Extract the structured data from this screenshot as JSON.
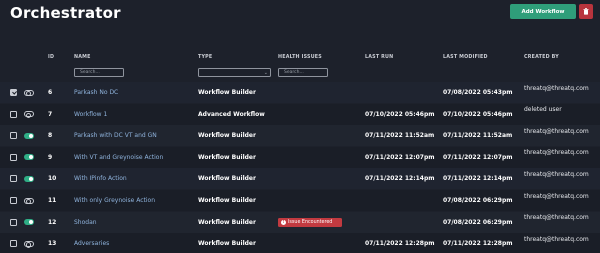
{
  "header": {
    "title": "Orchestrator",
    "add_label": "Add Workflow",
    "delete_icon": "trash-icon"
  },
  "columns": {
    "id": "ID",
    "name": "NAME",
    "type": "TYPE",
    "health": "HEALTH ISSUES",
    "last_run": "LAST RUN",
    "last_modified": "LAST MODIFIED",
    "created_by": "CREATED BY"
  },
  "filters": {
    "name_placeholder": "Search...",
    "type_value": "",
    "health_placeholder": "Search..."
  },
  "colors": {
    "accent": "#2f9e7a",
    "danger": "#b8343d",
    "link": "#8fb3dc"
  },
  "rows": [
    {
      "checked": true,
      "enabled": false,
      "id": "6",
      "name": "Parkash No DC",
      "type": "Workflow Builder",
      "health": "",
      "last_run": "",
      "last_modified": "07/08/2022 05:43pm",
      "created_by": "threatq@threatq.com"
    },
    {
      "checked": false,
      "enabled": false,
      "id": "7",
      "name": "Workflow 1",
      "type": "Advanced Workflow",
      "health": "",
      "last_run": "07/10/2022 05:46pm",
      "last_modified": "07/10/2022 05:46pm",
      "created_by": "deleted user"
    },
    {
      "checked": false,
      "enabled": true,
      "id": "8",
      "name": "Parkash with DC VT and GN",
      "type": "Workflow Builder",
      "health": "",
      "last_run": "07/11/2022 11:52am",
      "last_modified": "07/11/2022 11:52am",
      "created_by": "threatq@threatq.com"
    },
    {
      "checked": false,
      "enabled": true,
      "id": "9",
      "name": "With VT and Greynoise Action",
      "type": "Workflow Builder",
      "health": "",
      "last_run": "07/11/2022 12:07pm",
      "last_modified": "07/11/2022 12:07pm",
      "created_by": "threatq@threatq.com"
    },
    {
      "checked": false,
      "enabled": true,
      "id": "10",
      "name": "With IPinfo Action",
      "type": "Workflow Builder",
      "health": "",
      "last_run": "07/11/2022 12:14pm",
      "last_modified": "07/11/2022 12:14pm",
      "created_by": "threatq@threatq.com"
    },
    {
      "checked": false,
      "enabled": false,
      "id": "11",
      "name": "With only Greynoise Action",
      "type": "Workflow Builder",
      "health": "",
      "last_run": "",
      "last_modified": "07/08/2022 06:29pm",
      "created_by": "threatq@threatq.com"
    },
    {
      "checked": false,
      "enabled": true,
      "id": "12",
      "name": "Shodan",
      "type": "Workflow Builder",
      "health": "Issue Encountered",
      "last_run": "",
      "last_modified": "07/08/2022 06:29pm",
      "created_by": "threatq@threatq.com"
    },
    {
      "checked": false,
      "enabled": false,
      "id": "13",
      "name": "Adversaries",
      "type": "Workflow Builder",
      "health": "",
      "last_run": "07/11/2022 12:28pm",
      "last_modified": "07/11/2022 12:28pm",
      "created_by": "threatq@threatq.com"
    }
  ]
}
